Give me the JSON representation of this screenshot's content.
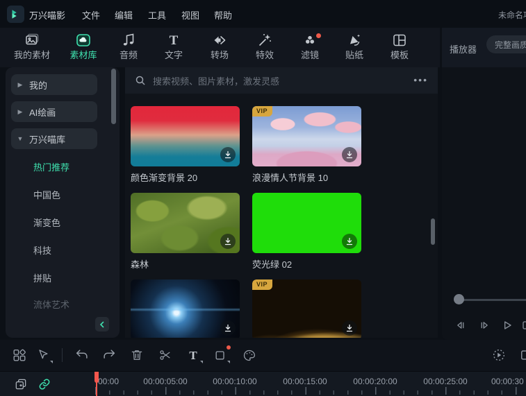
{
  "app": {
    "title": "万兴喵影",
    "project_name": "未命名项"
  },
  "menubar": {
    "items": [
      "文件",
      "编辑",
      "工具",
      "视图",
      "帮助"
    ]
  },
  "tabs": {
    "items": [
      "我的素材",
      "素材库",
      "音频",
      "文字",
      "转场",
      "特效",
      "滤镜",
      "贴纸",
      "模板"
    ],
    "active": "素材库"
  },
  "sidebar": {
    "groups": [
      "我的",
      "AI绘画",
      "万兴喵库"
    ],
    "subitems": [
      "热门推荐",
      "中国色",
      "渐变色",
      "科技",
      "拼贴",
      "流体艺术"
    ],
    "active_subitem": "热门推荐"
  },
  "search": {
    "placeholder": "搜索视频、图片素材，激发灵感",
    "more": "•••"
  },
  "library": {
    "items": [
      {
        "label": "颜色渐变背景 20",
        "badge": ""
      },
      {
        "label": "浪漫情人节背景 10",
        "badge": "VIP"
      },
      {
        "label": "森林",
        "badge": ""
      },
      {
        "label": "荧光绿 02",
        "badge": ""
      },
      {
        "label": "",
        "badge": ""
      },
      {
        "label": "",
        "badge": "VIP"
      }
    ]
  },
  "player": {
    "title": "播放器",
    "quality_label": "完整画质"
  },
  "timeline": {
    "labels": [
      "00:00",
      "00:00:05:00",
      "00:00:10:00",
      "00:00:15:00",
      "00:00:20:00",
      "00:00:25:00",
      "00:00:30"
    ]
  },
  "colors": {
    "accent": "#3fe0ae",
    "alert_red": "#ee5a4a",
    "vip_gold": "#d7a63e",
    "green_screen": "#1fdd0a",
    "playhead_red": "#f4574d"
  }
}
